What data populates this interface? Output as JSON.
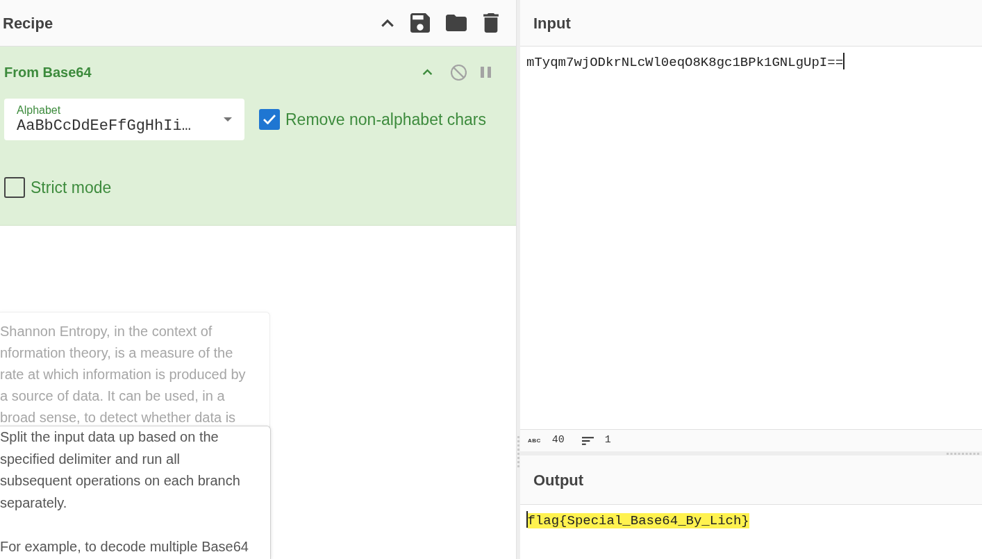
{
  "recipe": {
    "title": "Recipe"
  },
  "operation": {
    "name": "From Base64",
    "disabled": false,
    "breakpoint": false,
    "args": [
      {
        "kind": "select",
        "label": "Alphabet",
        "value": "AaBbCcDdEeFfGgHhIi…"
      },
      {
        "kind": "checkbox",
        "label": "Remove non-alphabet chars",
        "checked": true
      },
      {
        "kind": "checkbox",
        "label": "Strict mode",
        "checked": false
      }
    ]
  },
  "popovers": [
    {
      "kind": "faded",
      "lines": [
        "Shannon Entropy, in the context of",
        "nformation theory, is a measure of the",
        "rate at which information is produced by",
        "a source of data. It can be used, in a",
        "broad sense, to detect whether data is"
      ]
    },
    {
      "kind": "active",
      "paragraphs": [
        "Split the input data up based on the specified delimiter and run all subsequent operations on each branch separately.",
        "For example, to decode multiple Base64"
      ]
    }
  ],
  "input": {
    "title": "Input",
    "value": "mTyqm7wjODkrNLcWl0eqO8K8gc1BPk1GNLgUpI==",
    "length_label": "ABC",
    "length": "40",
    "lines": "1"
  },
  "output": {
    "title": "Output",
    "value": "flag{Special_Base64_By_Lich}",
    "highlighted": true
  }
}
